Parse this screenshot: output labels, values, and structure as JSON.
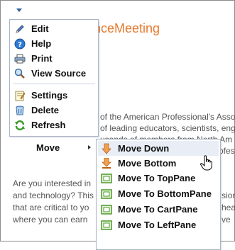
{
  "page": {
    "title_fragment": "vanceMeeting",
    "paragraph1": [
      "of the American Professional's Assoc",
      "of leading educators, scientists, eng",
      "usands of members from North Am",
      "rofess"
    ],
    "paragraph2": [
      "Are you interested in",
      "and technology? This",
      "that are critical to yo",
      "where you can earn"
    ],
    "paragraph2_right": [
      "sion",
      "hea",
      "ve"
    ]
  },
  "menu": {
    "items": [
      {
        "label": "Edit",
        "icon": "pencil-icon"
      },
      {
        "label": "Help",
        "icon": "help-icon"
      },
      {
        "label": "Print",
        "icon": "print-icon"
      },
      {
        "label": "View Source",
        "icon": "magnifier-icon"
      },
      {
        "label": "Settings",
        "icon": "settings-icon"
      },
      {
        "label": "Delete",
        "icon": "trash-icon"
      },
      {
        "label": "Refresh",
        "icon": "refresh-icon"
      },
      {
        "label": "Move",
        "icon": ""
      }
    ]
  },
  "submenu": {
    "items": [
      {
        "label": "Move Down",
        "icon": "arrow-down-icon"
      },
      {
        "label": "Move Bottom",
        "icon": "arrow-bottom-icon"
      },
      {
        "label": "Move To TopPane",
        "icon": "pane-icon"
      },
      {
        "label": "Move To BottomPane",
        "icon": "pane-icon"
      },
      {
        "label": "Move To CartPane",
        "icon": "pane-icon"
      },
      {
        "label": "Move To LeftPane",
        "icon": "pane-icon"
      }
    ],
    "hovered_index": 0
  },
  "colors": {
    "title": "#e8792c",
    "menu_border": "#a9b6c8",
    "pane_icon": "#5aa832",
    "arrow_icon": "#e8892c"
  }
}
